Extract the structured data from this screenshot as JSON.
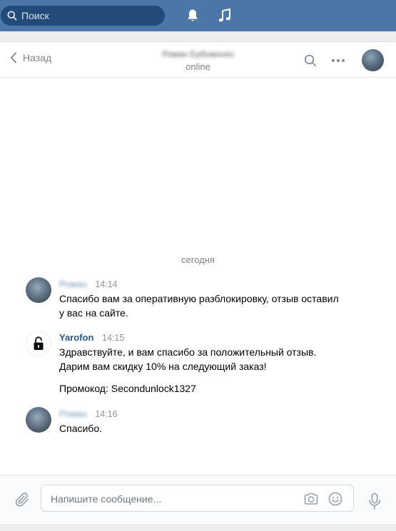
{
  "topbar": {
    "search_placeholder": "Поиск",
    "icons": [
      "search-icon",
      "bell-icon",
      "music-icon"
    ]
  },
  "chat_header": {
    "back_label": "Назад",
    "contact_name": "Роман Ербоженко",
    "status": "online"
  },
  "date_separator": "сегодня",
  "messages": [
    {
      "author": "Роман",
      "time": "14:14",
      "lines": [
        "Спасибо вам за оперативную разблокировку, отзыв оставил у вас на сайте."
      ]
    },
    {
      "author": "Yarofon",
      "time": "14:15",
      "lines": [
        "Здравствуйте, и вам спасибо за положительный отзыв. Дарим вам скидку 10% на следующий заказ!",
        "Промокод: Secondunlock1327"
      ]
    },
    {
      "author": "Роман",
      "time": "14:16",
      "lines": [
        "Спасибо."
      ]
    }
  ],
  "composer": {
    "placeholder": "Напишите сообщение..."
  },
  "colors": {
    "topbar": "#4a76a8",
    "search_bg": "#224b7a",
    "link": "#2a5885",
    "muted": "#828282"
  }
}
